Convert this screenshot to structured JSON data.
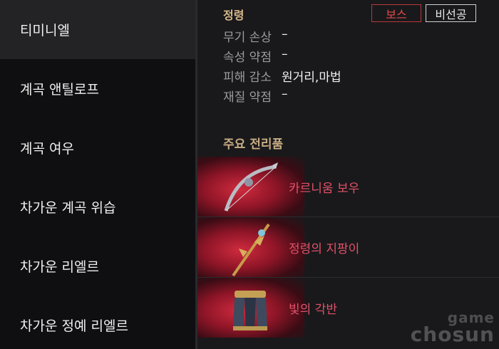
{
  "sidebar": {
    "items": [
      {
        "label": "티미니엘"
      },
      {
        "label": "계곡 앤틸로프"
      },
      {
        "label": "계곡 여우"
      },
      {
        "label": "차가운 계곡 위습"
      },
      {
        "label": "차가운 리엘르"
      },
      {
        "label": "차가운 정예 리엘르"
      }
    ],
    "active_index": 0
  },
  "monster": {
    "type": "정령",
    "badges": [
      "보스",
      "비선공"
    ],
    "attributes": [
      {
        "label": "무기 손상",
        "value": "–"
      },
      {
        "label": "속성 약점",
        "value": "–"
      },
      {
        "label": "피해 감소",
        "value": "원거리,마법"
      },
      {
        "label": "재질 약점",
        "value": "–"
      }
    ]
  },
  "loot": {
    "title": "주요 전리품",
    "items": [
      {
        "name": "카르니움 보우",
        "icon": "bow-icon"
      },
      {
        "name": "정령의 지팡이",
        "icon": "staff-icon"
      },
      {
        "name": "빛의 각반",
        "icon": "greaves-icon"
      }
    ]
  },
  "watermark": {
    "line1": "game",
    "line2": "chosun"
  },
  "colors": {
    "loot_name": "#e4516a",
    "boss_badge": "#e24a4a",
    "section_title": "#c9ad85"
  }
}
